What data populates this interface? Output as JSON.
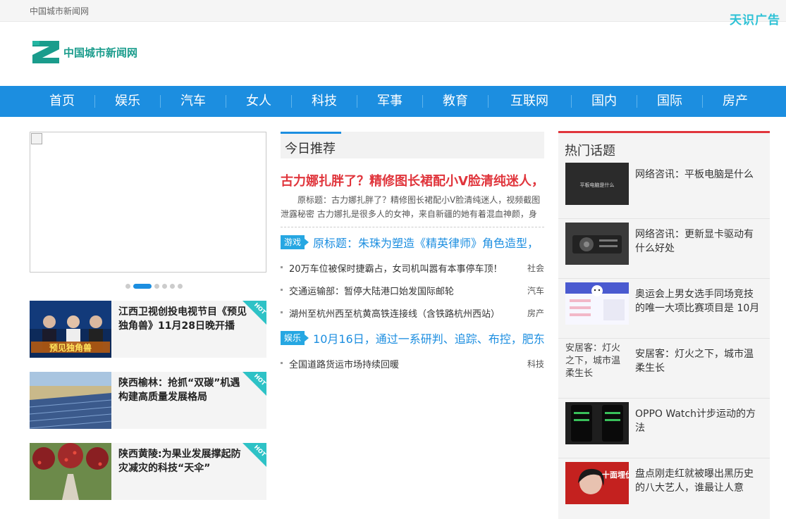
{
  "topbar": {
    "site_name": "中国城市新闻网",
    "ad_text": "天识广告"
  },
  "logo": {
    "text": "中国城市新闻网"
  },
  "nav": [
    "首页",
    "娱乐",
    "汽车",
    "女人",
    "科技",
    "军事",
    "教育",
    "互联网",
    "国内",
    "国际",
    "房产"
  ],
  "slider": {
    "dot_count": 6,
    "active_dot": 2
  },
  "features": [
    {
      "title": "江西卫视创投电视节目《预见独角兽》11月28日晚开播",
      "thumb_caption": "预见独角兽",
      "badge": "HOT"
    },
    {
      "title": "陕西榆林：抢抓“双碳”机遇 构建高质量发展格局",
      "badge": "HOT"
    },
    {
      "title": "陕西黄陵:为果业发展撑起防灾减灾的科技“天伞”",
      "badge": "HOT"
    }
  ],
  "today": {
    "heading": "今日推荐",
    "headline": "古力娜扎胖了？精修图长裙配小V脸清纯迷人，",
    "summary": "原标题：古力娜扎胖了？精修图长裙配小V脸清纯迷人，视频截图泄露秘密 古力娜扎是很多人的女神，来自新疆的她有着混血神颜，身",
    "tagged": [
      {
        "tag": "游戏",
        "title": "原标题：朱珠为塑造《精英律师》角色造型，"
      },
      {
        "tag": "娱乐",
        "title": "10月16日，通过一系研判、追踪、布控，肥东"
      }
    ],
    "news_group1": [
      {
        "title": "20万车位被保时捷霸占，女司机叫嚣有本事停车顶！",
        "category": "社会"
      },
      {
        "title": "交通运输部：暂停大陆港口始发国际邮轮",
        "category": "汽车"
      },
      {
        "title": "湖州至杭州西至杭黄高铁连接线（含铁路杭州西站）",
        "category": "房产"
      }
    ],
    "news_group2": [
      {
        "title": "全国道路货运市场持续回暖",
        "category": "科技"
      }
    ]
  },
  "hot_topics": {
    "heading": "热门话题",
    "items": [
      {
        "title": "网络咨讯：平板电脑是什么",
        "thumb_text": "平板电脑是什么"
      },
      {
        "title": "网络咨讯：更新显卡驱动有什么好处"
      },
      {
        "title": "奥运会上男女选手同场竞技的唯一大项比赛项目是 10月"
      },
      {
        "title": "安居客：灯火之下，城市温柔生长",
        "image_alt": "安居客：灯火之下，城市温柔生长"
      },
      {
        "title": "OPPO Watch计步运动的方法"
      },
      {
        "title": "盘点刚走红就被曝出黑历史的八大艺人，谁最让人意",
        "thumb_text": "十面埋伏"
      }
    ]
  },
  "colors": {
    "nav_blue": "#1c8ee0",
    "headline_red": "#e0353c",
    "brand_teal": "#1a9c8c",
    "ad_cyan": "#2ec2d6"
  }
}
